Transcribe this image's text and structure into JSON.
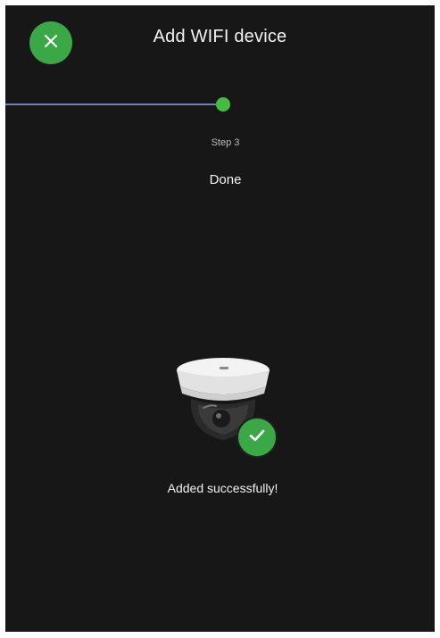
{
  "header": {
    "title": "Add WIFI device",
    "close_icon": "close-x-icon"
  },
  "progress": {
    "step_label": "Step 3",
    "step_name": "Done",
    "accent_color": "#3fbf3f",
    "line_color": "#6a7fb6"
  },
  "result": {
    "device_icon": "dome-camera-icon",
    "status_icon": "checkmark-icon",
    "message": "Added successfully!"
  },
  "colors": {
    "background": "#171717",
    "accent": "#3aa845"
  }
}
